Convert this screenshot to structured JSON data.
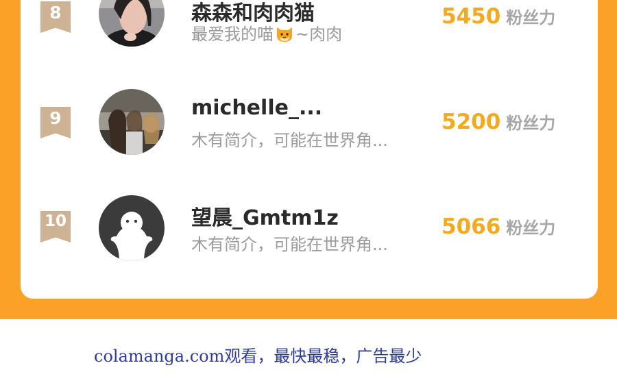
{
  "leaderboard": {
    "items": [
      {
        "rank": "8",
        "name": "森森和肉肉猫",
        "bio_before": "最爱我的喵",
        "bio_emoji": "cat-face-icon",
        "bio_after": "~肉肉",
        "fans": "5450",
        "fans_label": "粉丝力"
      },
      {
        "rank": "9",
        "name": "michelle_...",
        "bio": "木有简介，可能在世界角...",
        "fans": "5200",
        "fans_label": "粉丝力"
      },
      {
        "rank": "10",
        "name": "望晨_Gmtm1z",
        "bio": "木有简介，可能在世界角...",
        "fans": "5066",
        "fans_label": "粉丝力"
      }
    ]
  },
  "footer": {
    "text": "colamanga.com观看，最快最稳，广告最少"
  },
  "colors": {
    "page_orange": "#fca127",
    "fans_orange": "#f5a91f",
    "rank_badge": "#cdb293",
    "footer_text": "#2d3a9c"
  }
}
